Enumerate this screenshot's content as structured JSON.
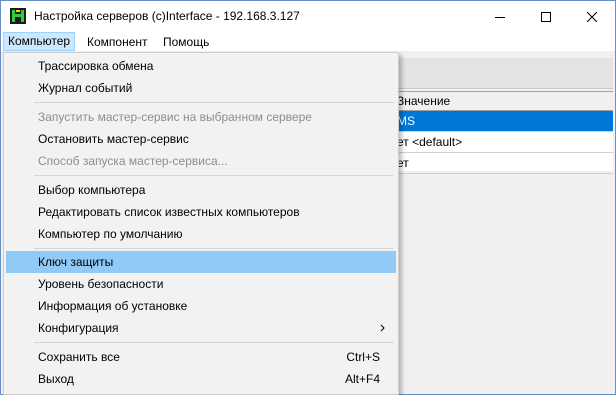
{
  "window": {
    "title": "Настройка серверов (c)Interface - 192.168.3.127",
    "icon": "app-icon"
  },
  "menubar": [
    {
      "label": "Компьютер"
    },
    {
      "label": "Компонент"
    },
    {
      "label": "Помощь"
    }
  ],
  "grid": {
    "header": "Значение",
    "rows": [
      "MS",
      "ет <default>",
      "ет"
    ]
  },
  "menu": {
    "items": [
      {
        "label": "Трассировка обмена",
        "enabled": true
      },
      {
        "label": "Журнал событий",
        "enabled": true
      },
      {
        "label": "Запустить мастер-сервис на выбранном сервере",
        "enabled": false
      },
      {
        "label": "Остановить мастер-сервис",
        "enabled": true
      },
      {
        "label": "Способ запуска мастер-сервиса...",
        "enabled": false
      },
      {
        "label": "Выбор компьютера",
        "enabled": true
      },
      {
        "label": "Редактировать список известных компьютеров",
        "enabled": true
      },
      {
        "label": "Компьютер по умолчанию",
        "enabled": true
      },
      {
        "label": "Ключ защиты",
        "enabled": true,
        "highlighted": true
      },
      {
        "label": "Уровень безопасности",
        "enabled": true
      },
      {
        "label": "Информация об установке",
        "enabled": true
      },
      {
        "label": "Конфигурация",
        "enabled": true,
        "submenu": true
      },
      {
        "label": "Сохранить все",
        "shortcut": "Ctrl+S",
        "enabled": true
      },
      {
        "label": "Выход",
        "shortcut": "Alt+F4",
        "enabled": true
      }
    ]
  },
  "colors": {
    "highlight": "#91c9f7",
    "selection": "#0078d7",
    "disabled_text": "#8d8d8d"
  }
}
